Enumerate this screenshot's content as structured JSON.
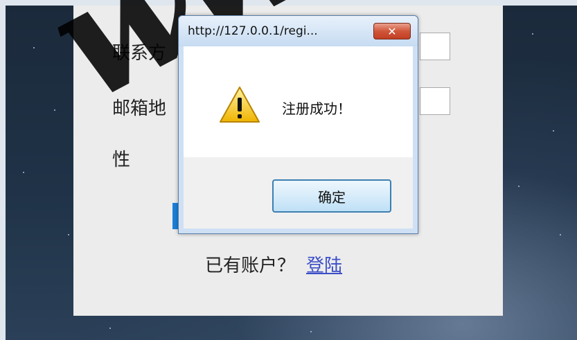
{
  "form": {
    "contact_label": "联系方",
    "email_label": "邮箱地",
    "gender_label": "性",
    "login_prompt": "已有账户？",
    "login_link": "登陆"
  },
  "dialog": {
    "title": "http://127.0.0.1/regi...",
    "close_label": "✕",
    "message": "注册成功！",
    "ok_label": "确定",
    "icon": "warning-icon"
  },
  "watermark": {
    "text": "www.j"
  },
  "colors": {
    "link": "#3b4ec8",
    "close_button": "#c23e22",
    "ok_border": "#3c7fb1"
  }
}
